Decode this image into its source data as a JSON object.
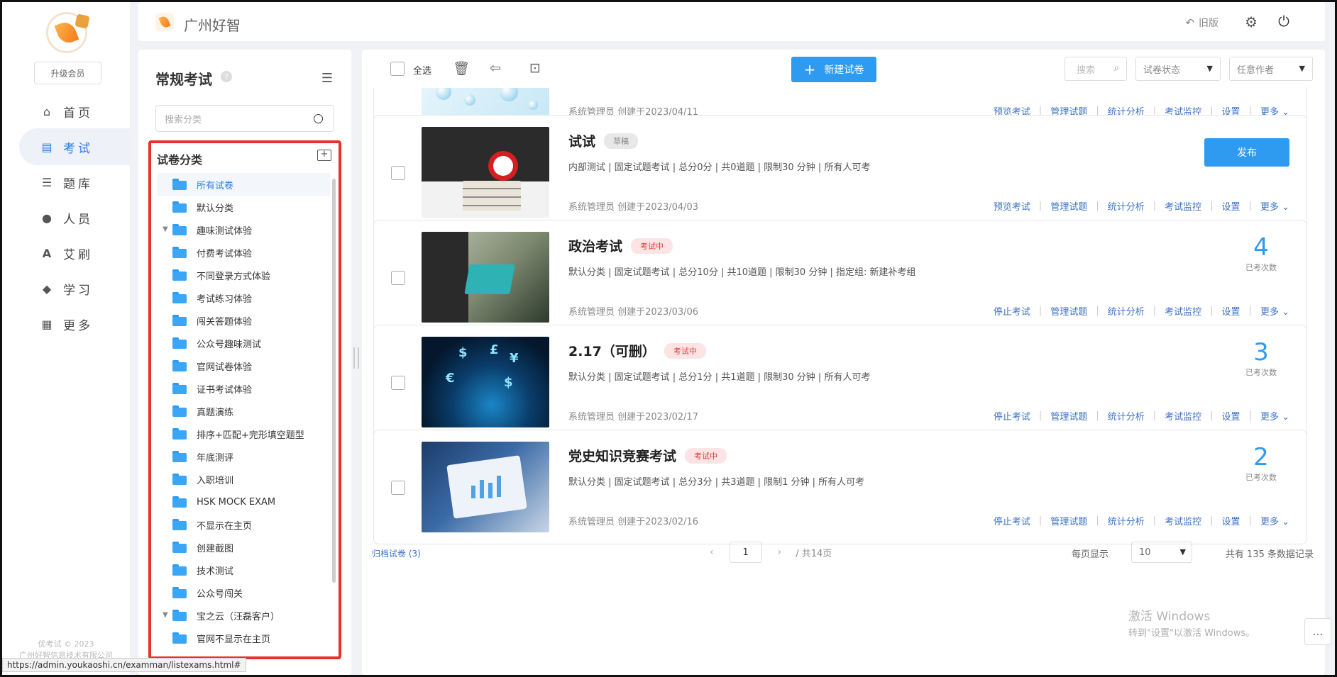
{
  "sidebar": {
    "upgrade_label": "升级会员",
    "items": [
      {
        "label": "首页"
      },
      {
        "label": "考试"
      },
      {
        "label": "题库"
      },
      {
        "label": "人员"
      },
      {
        "label": "艾刷"
      },
      {
        "label": "学习"
      },
      {
        "label": "更多"
      }
    ],
    "copyright_line1": "优考试 © 2023",
    "copyright_line2": "广州好智信息技术有限公司"
  },
  "header": {
    "brand": "广州好智",
    "old_version": "旧版"
  },
  "category_panel": {
    "title": "常规考试",
    "help": "?",
    "search_placeholder": "搜索分类",
    "tree_title": "试卷分类",
    "tree": [
      {
        "label": "所有试卷",
        "selected": true
      },
      {
        "label": "默认分类"
      },
      {
        "label": "趣味测试体验",
        "expanded": true
      },
      {
        "label": "付费考试体验"
      },
      {
        "label": "不同登录方式体验"
      },
      {
        "label": "考试练习体验"
      },
      {
        "label": "闯关答题体验"
      },
      {
        "label": "公众号趣味测试"
      },
      {
        "label": "官网试卷体验"
      },
      {
        "label": "证书考试体验"
      },
      {
        "label": "真题演练"
      },
      {
        "label": "排序+匹配+完形填空题型"
      },
      {
        "label": "年底测评"
      },
      {
        "label": "入职培训"
      },
      {
        "label": "HSK MOCK EXAM"
      },
      {
        "label": "不显示在主页"
      },
      {
        "label": "创建截图"
      },
      {
        "label": "技术测试"
      },
      {
        "label": "公众号闯关"
      },
      {
        "label": "宝之云（汪磊客户）",
        "expanded": true
      },
      {
        "label": "官网不显示在主页"
      }
    ]
  },
  "toolbar": {
    "select_all": "全选",
    "new_exam": "新建试卷",
    "search_placeholder": "搜索",
    "status_filter": "试卷状态",
    "author_filter": "任意作者"
  },
  "exams": [
    {
      "title": "",
      "badge": "",
      "meta": "",
      "author": "系统管理员 创建于2023/04/11",
      "actions": [
        "预览考试",
        "管理试题",
        "统计分析",
        "考试监控",
        "设置"
      ],
      "more": "更多"
    },
    {
      "title": "试试",
      "badge": "草稿",
      "meta": "内部测试 | 固定试题考试 | 总分0分 | 共0道题 | 限制30 分钟 | 所有人可考",
      "author": "系统管理员 创建于2023/04/03",
      "actions": [
        "预览考试",
        "管理试题",
        "统计分析",
        "考试监控",
        "设置"
      ],
      "more": "更多",
      "publish": "发布"
    },
    {
      "title": "政治考试",
      "badge": "考试中",
      "meta": "默认分类 | 固定试题考试 | 总分10分 | 共10道题 | 限制30 分钟 | 指定组: 新建补考组",
      "author": "系统管理员 创建于2023/03/06",
      "actions": [
        "停止考试",
        "管理试题",
        "统计分析",
        "考试监控",
        "设置"
      ],
      "more": "更多",
      "count": 4,
      "count_label": "已考次数"
    },
    {
      "title": "2.17（可删）",
      "badge": "考试中",
      "meta": "默认分类 | 固定试题考试 | 总分1分 | 共1道题 | 限制30 分钟 | 所有人可考",
      "author": "系统管理员 创建于2023/02/17",
      "actions": [
        "停止考试",
        "管理试题",
        "统计分析",
        "考试监控",
        "设置"
      ],
      "more": "更多",
      "count": 3,
      "count_label": "已考次数"
    },
    {
      "title": "党史知识竞赛考试",
      "badge": "考试中",
      "meta": "默认分类 | 固定试题考试 | 总分3分 | 共3道题 | 限制1 分钟 | 所有人可考",
      "author": "系统管理员 创建于2023/02/16",
      "actions": [
        "停止考试",
        "管理试题",
        "统计分析",
        "考试监控",
        "设置"
      ],
      "more": "更多",
      "count": 2,
      "count_label": "已考次数"
    }
  ],
  "footer": {
    "archived": "归档试卷 (3)",
    "current_page": "1",
    "total_pages": "/ 共14页",
    "per_page_label": "每页显示",
    "per_page_value": "10",
    "total_records": "共有 135 条数据记录"
  },
  "overlay": {
    "activate_title": "激活 Windows",
    "activate_hint": "转到\"设置\"以激活 Windows。",
    "status_url": "https://admin.youkaoshi.cn/examman/listexams.html#"
  }
}
